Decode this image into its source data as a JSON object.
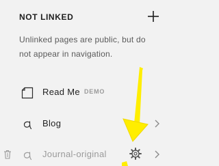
{
  "section": {
    "title": "NOT LINKED",
    "add_icon": "plus-icon",
    "note": "Unlinked pages are public, but do not appear in navigation."
  },
  "pages": [
    {
      "label": "Read Me",
      "badge": "DEMO",
      "icon": "page-icon"
    },
    {
      "label": "Blog",
      "icon": "blog-script-a-icon",
      "chevron": "chevron-right-icon"
    },
    {
      "label": "Journal-original",
      "icon": "blog-script-a-icon",
      "chevron": "chevron-right-icon",
      "trash_icon": "trash-icon",
      "settings_icon": "gear-icon"
    }
  ],
  "colors": {
    "background": "#f2f2f2",
    "text": "#222222",
    "muted": "#9a9a9a",
    "annotation_arrow": "#ffee00"
  },
  "annotation": {
    "icon": "yellow-arrow-pointer"
  }
}
